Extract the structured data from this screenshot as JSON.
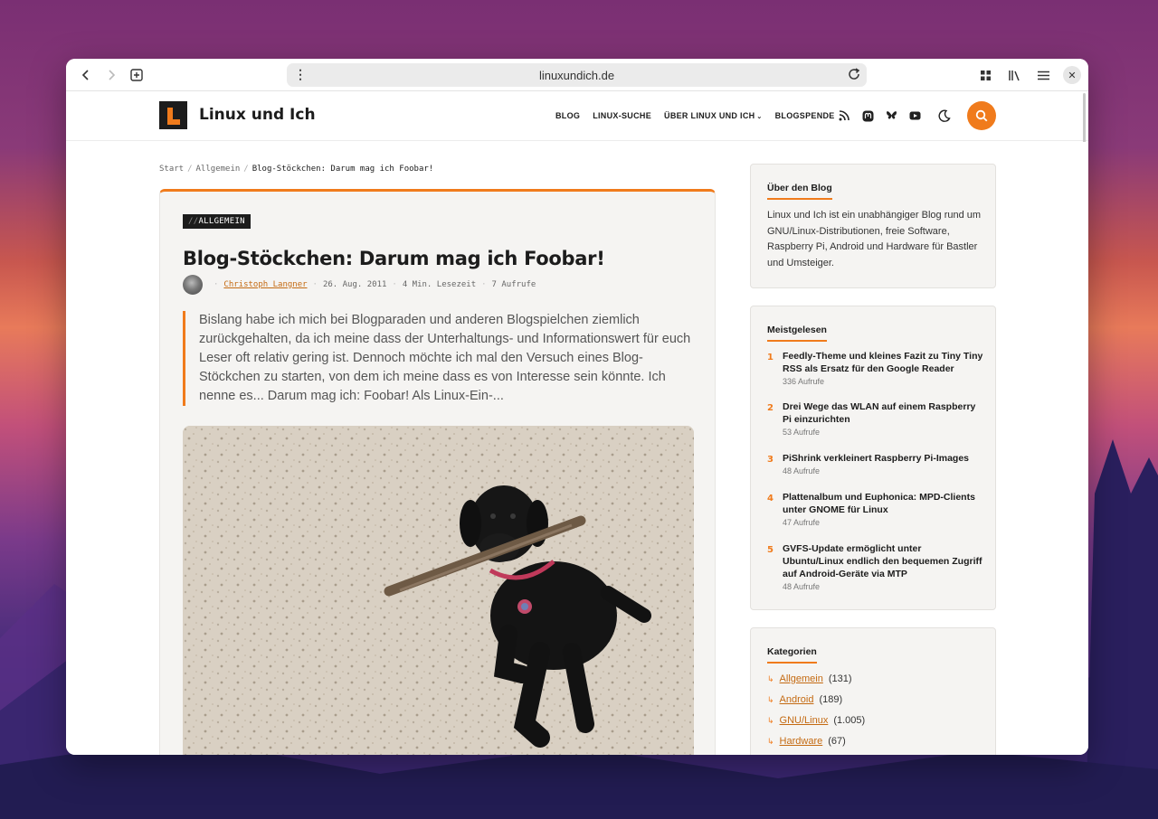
{
  "browser": {
    "url": "linuxundich.de"
  },
  "site": {
    "title": "Linux und Ich",
    "nav": [
      "BLOG",
      "LINUX-SUCHE",
      "ÜBER LINUX UND ICH",
      "BLOGSPENDE"
    ],
    "accent_color": "#f07b1c"
  },
  "breadcrumb": {
    "home": "Start",
    "category": "Allgemein",
    "current": "Blog-Stöckchen: Darum mag ich Foobar!"
  },
  "article": {
    "category_prefix": "//",
    "category": "ALLGEMEIN",
    "title": "Blog-Stöckchen: Darum mag ich Foobar!",
    "author": "Christoph Langner",
    "date": "26. Aug. 2011",
    "read_time": "4 Min. Lesezeit",
    "views": "7 Aufrufe",
    "excerpt": "Bislang habe ich mich bei Blogparaden und anderen Blogspielchen ziemlich zurückgehalten, da ich meine dass der Unterhaltungs- und Informationswert für euch Leser oft relativ gering ist. Dennoch möchte ich mal den Versuch eines Blog-Stöckchen zu starten, von dem ich meine dass es von Interesse sein könnte. Ich nenne es... Darum mag ich: Foobar! Als Linux-Ein-..."
  },
  "sidebar": {
    "about": {
      "title": "Über den Blog",
      "text": "Linux und Ich ist ein unabhängiger Blog rund um GNU/Linux-Distributionen, freie Software, Raspberry Pi, Android und Hardware für Bastler und Umsteiger."
    },
    "most_read": {
      "title": "Meistgelesen",
      "items": [
        {
          "num": "1",
          "title": "Feedly-Theme und kleines Fazit zu Tiny Tiny RSS als Ersatz für den Google Reader",
          "views": "336 Aufrufe"
        },
        {
          "num": "2",
          "title": "Drei Wege das WLAN auf einem Raspberry Pi einzurichten",
          "views": "53 Aufrufe"
        },
        {
          "num": "3",
          "title": "PiShrink verkleinert Raspberry Pi-Images",
          "views": "48 Aufrufe"
        },
        {
          "num": "4",
          "title": "Plattenalbum und Euphonica: MPD-Clients unter GNOME für Linux",
          "views": "47 Aufrufe"
        },
        {
          "num": "5",
          "title": "GVFS-Update ermöglicht unter Ubuntu/Linux endlich den bequemen Zugriff auf Android-Geräte via MTP",
          "views": "48 Aufrufe"
        }
      ]
    },
    "categories": {
      "title": "Kategorien",
      "items": [
        {
          "name": "Allgemein",
          "count": "(131)"
        },
        {
          "name": "Android",
          "count": "(189)"
        },
        {
          "name": "GNU/Linux",
          "count": "(1.005)"
        },
        {
          "name": "Hardware",
          "count": "(67)"
        }
      ]
    }
  }
}
